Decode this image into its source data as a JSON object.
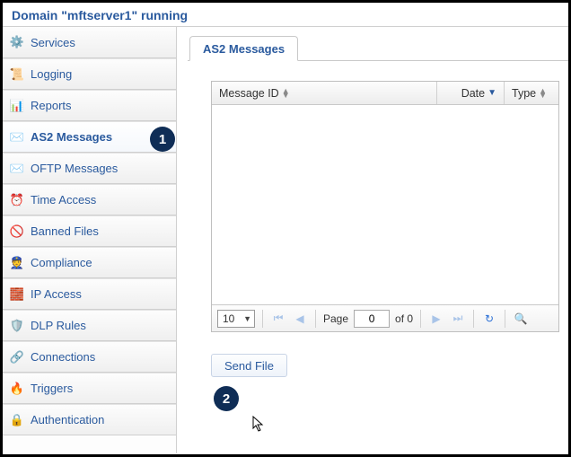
{
  "header": {
    "title": "Domain \"mftserver1\" running"
  },
  "sidebar": {
    "items": [
      {
        "label": "Services"
      },
      {
        "label": "Logging"
      },
      {
        "label": "Reports"
      },
      {
        "label": "AS2 Messages"
      },
      {
        "label": "OFTP Messages"
      },
      {
        "label": "Time Access"
      },
      {
        "label": "Banned Files"
      },
      {
        "label": "Compliance"
      },
      {
        "label": "IP Access"
      },
      {
        "label": "DLP Rules"
      },
      {
        "label": "Connections"
      },
      {
        "label": "Triggers"
      },
      {
        "label": "Authentication"
      }
    ]
  },
  "tab": {
    "label": "AS2 Messages"
  },
  "grid": {
    "columns": {
      "message_id": "Message ID",
      "date": "Date",
      "type": "Type"
    },
    "rows": []
  },
  "pager": {
    "page_size": "10",
    "page_label": "Page",
    "current_page": "0",
    "of_label": "of 0"
  },
  "actions": {
    "send_file": "Send File"
  },
  "callouts": {
    "one": "1",
    "two": "2"
  }
}
